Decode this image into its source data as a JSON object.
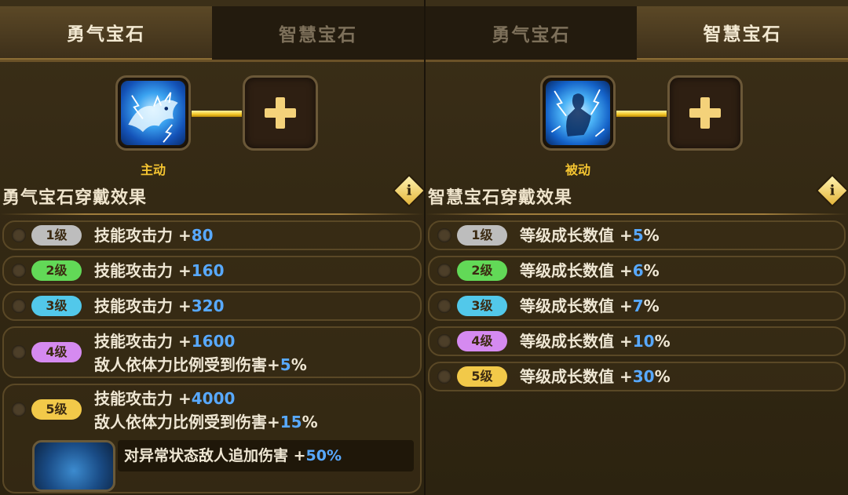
{
  "left": {
    "tabs": [
      {
        "label": "勇气宝石",
        "active": true
      },
      {
        "label": "智慧宝石",
        "active": false
      }
    ],
    "gem": {
      "caption": "主动",
      "icon": "dragon-gem-icon"
    },
    "section_title": "勇气宝石穿戴效果",
    "info_label": "i",
    "rows": [
      {
        "level": "1级",
        "lines": [
          {
            "text": "技能攻击力 +",
            "value": "80",
            "suffix": ""
          }
        ]
      },
      {
        "level": "2级",
        "lines": [
          {
            "text": "技能攻击力 +",
            "value": "160",
            "suffix": ""
          }
        ]
      },
      {
        "level": "3级",
        "lines": [
          {
            "text": "技能攻击力 +",
            "value": "320",
            "suffix": ""
          }
        ]
      },
      {
        "level": "4级",
        "lines": [
          {
            "text": "技能攻击力 +",
            "value": "1600",
            "suffix": ""
          },
          {
            "text": "敌人依体力比例受到伤害+",
            "value": "5",
            "suffix": "%"
          }
        ]
      },
      {
        "level": "5级",
        "lines": [
          {
            "text": "技能攻击力 +",
            "value": "4000",
            "suffix": ""
          },
          {
            "text": "敌人依体力比例受到伤害+",
            "value": "15",
            "suffix": "%"
          }
        ],
        "sub_effect": {
          "text": "对异常状态敌人追加伤害 +",
          "value": "50%"
        }
      }
    ]
  },
  "right": {
    "tabs": [
      {
        "label": "勇气宝石",
        "active": false
      },
      {
        "label": "智慧宝石",
        "active": true
      }
    ],
    "gem": {
      "caption": "被动",
      "icon": "lightning-warrior-gem-icon"
    },
    "section_title": "智慧宝石穿戴效果",
    "info_label": "i",
    "rows": [
      {
        "level": "1级",
        "lines": [
          {
            "text": "等级成长数值 +",
            "value": "5",
            "suffix": "%"
          }
        ]
      },
      {
        "level": "2级",
        "lines": [
          {
            "text": "等级成长数值 +",
            "value": "6",
            "suffix": "%"
          }
        ]
      },
      {
        "level": "3级",
        "lines": [
          {
            "text": "等级成长数值 +",
            "value": "7",
            "suffix": "%"
          }
        ]
      },
      {
        "level": "4级",
        "lines": [
          {
            "text": "等级成长数值 +",
            "value": "10",
            "suffix": "%"
          }
        ]
      },
      {
        "level": "5级",
        "lines": [
          {
            "text": "等级成长数值 +",
            "value": "30",
            "suffix": "%"
          }
        ]
      }
    ]
  },
  "colors": {
    "accent_gold": "#f5c531",
    "value_blue": "#58a9ff",
    "level_1": "#bdbdbd",
    "level_2": "#62d957",
    "level_3": "#52c8ea",
    "level_4": "#d58af0",
    "level_5": "#f2c949"
  }
}
